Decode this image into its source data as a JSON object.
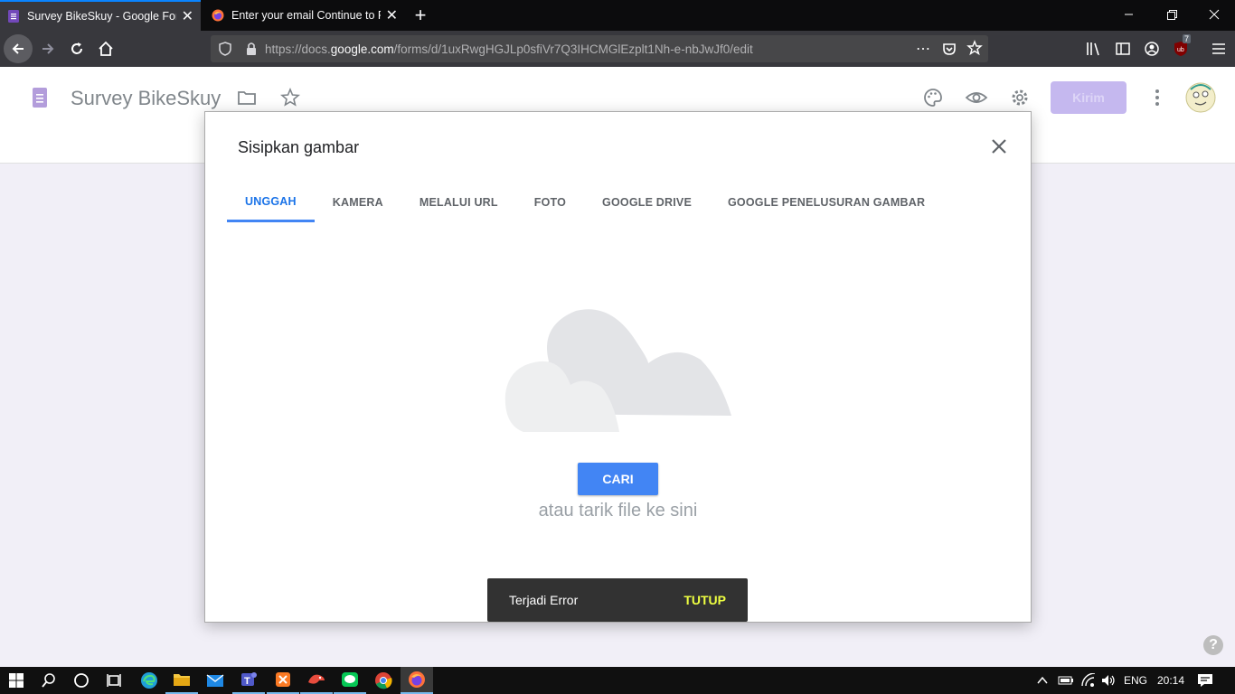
{
  "browser": {
    "tabs": [
      {
        "title": "Survey BikeSkuy - Google Forms",
        "active": true
      },
      {
        "title": "Enter your email Continue to Firefox",
        "active": false
      }
    ],
    "url_prefix": "https://docs.",
    "url_domain": "google.com",
    "url_path": "/forms/d/1uxRwgHGJLp0sfiVr7Q3IHCMGlEzplt1Nh-e-nbJwJf0/edit",
    "ublock_count": "7",
    "more_icon": "⋯"
  },
  "form": {
    "title": "Survey BikeSkuy",
    "send_label": "Kirim"
  },
  "dialog": {
    "title": "Sisipkan gambar",
    "tabs": [
      "UNGGAH",
      "KAMERA",
      "MELALUI URL",
      "FOTO",
      "GOOGLE DRIVE",
      "GOOGLE PENELUSURAN GAMBAR"
    ],
    "selected_tab": "UNGGAH",
    "browse_label": "CARI",
    "drop_text": "atau tarik file ke sini"
  },
  "snackbar": {
    "message": "Terjadi Error",
    "action": "TUTUP"
  },
  "help": "?",
  "taskbar": {
    "language": "ENG",
    "time": "20:14"
  },
  "colors": {
    "accent": "#4285f4",
    "form_purple": "#673ab7",
    "snack_action": "#eeff41"
  }
}
